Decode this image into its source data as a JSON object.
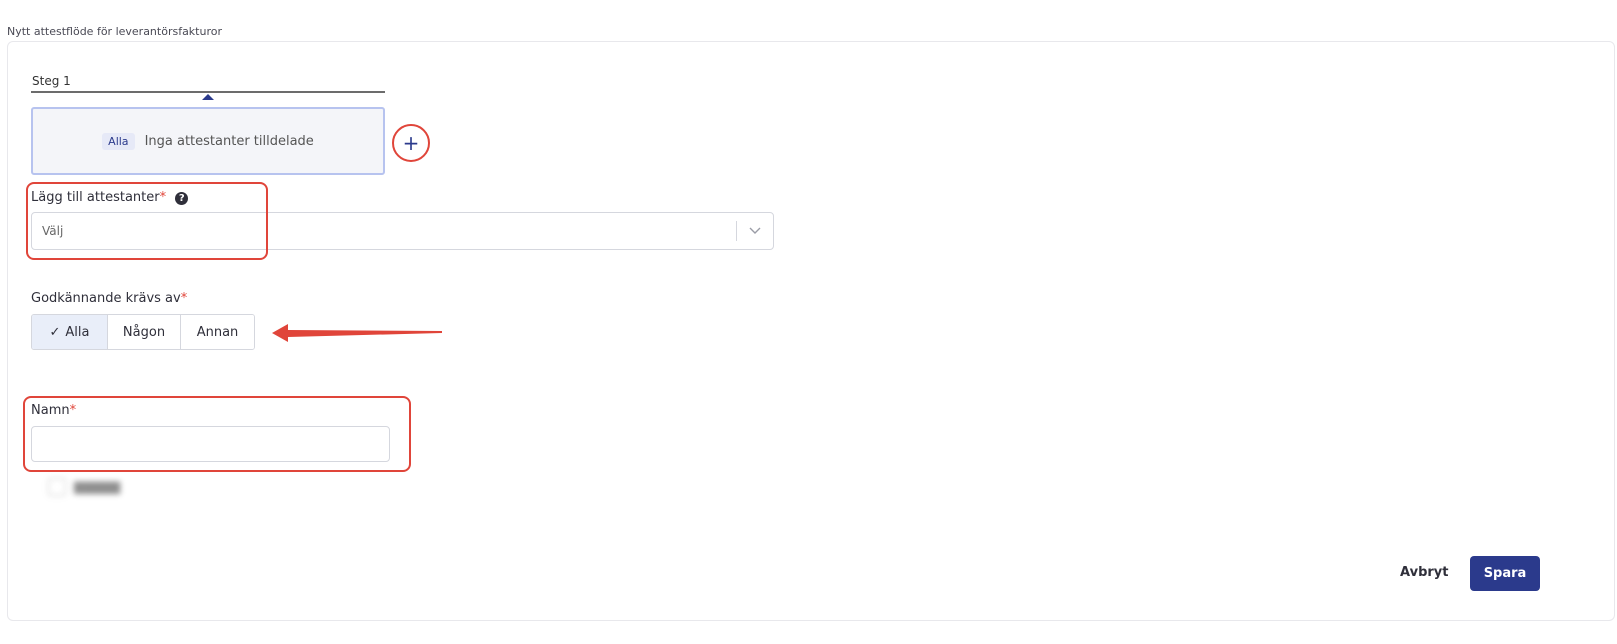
{
  "page": {
    "title": "Nytt attestflöde för leverantörsfakturor"
  },
  "step": {
    "title": "Steg 1",
    "badge": "Alla",
    "empty_text": "Inga attestanter tilldelade",
    "add_label": "+"
  },
  "attestants": {
    "label": "Lägg till attestanter",
    "required_mark": "*",
    "help_glyph": "?",
    "placeholder": "Välj"
  },
  "approval": {
    "label": "Godkännande krävs av",
    "required_mark": "*",
    "options": [
      {
        "label": "Alla",
        "checkmark": "✓",
        "selected": true
      },
      {
        "label": "Någon",
        "selected": false
      },
      {
        "label": "Annan",
        "selected": false
      }
    ]
  },
  "name": {
    "label": "Namn",
    "required_mark": "*",
    "value": ""
  },
  "footer": {
    "cancel_label": "Avbryt",
    "save_label": "Spara"
  },
  "colors": {
    "primary": "#2b3a8c",
    "annotation_red": "#e0453a",
    "selected_segment": "#e9eef9"
  }
}
